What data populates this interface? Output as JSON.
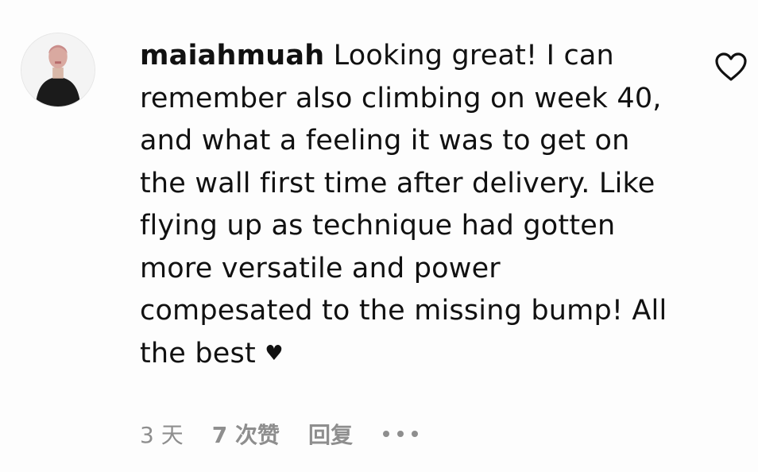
{
  "comment": {
    "username": "maiahmuah",
    "text": "Looking great! I can remember also climbing on week 40, and what a feeling it was to get on the wall first time after delivery. Like flying up as technique had gotten more versatile and power compesated to the missing bump! All the best",
    "trailing_emoji": "♥",
    "time": "3 天",
    "likes": "7 次赞",
    "reply_label": "回复",
    "more_icon": "ellipsis-icon",
    "like_icon": "heart-outline-icon"
  },
  "colors": {
    "text": "#111111",
    "meta": "#8e8e8e",
    "background": "#fdfdfd"
  }
}
